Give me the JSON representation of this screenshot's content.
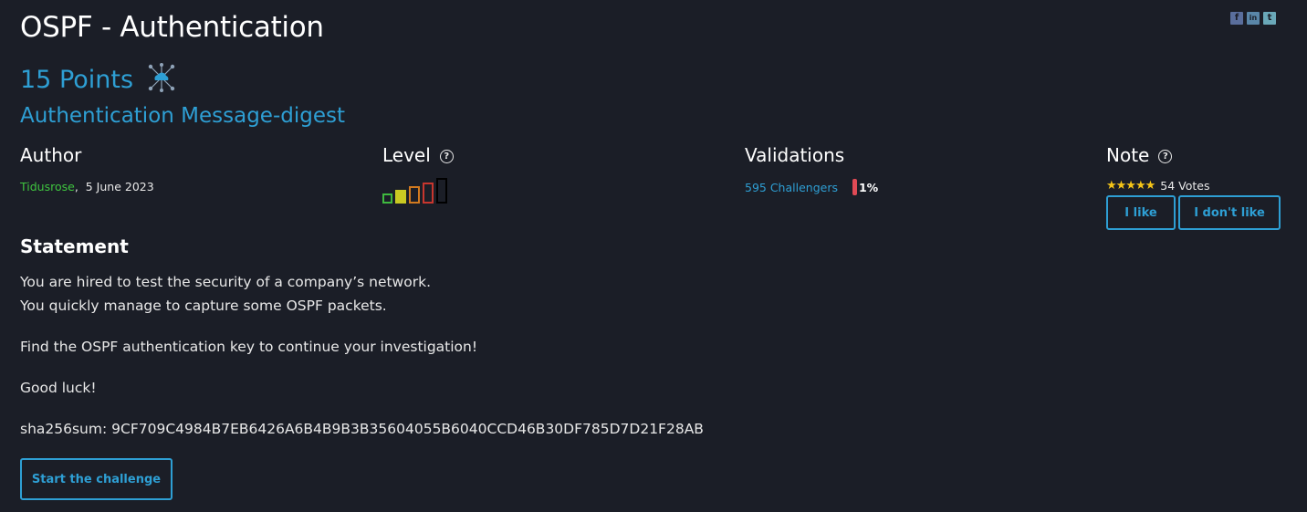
{
  "title": "OSPF - Authentication",
  "social": {
    "facebook": "f",
    "linkedin": "in",
    "twitter": "t"
  },
  "points": "15 Points",
  "category_icon": "cloud-network-icon",
  "subtitle": "Authentication Message-digest",
  "author": {
    "heading": "Author",
    "name": "Tidusrose",
    "separator": ",",
    "date": "5 June 2023"
  },
  "level": {
    "heading": "Level",
    "current": 2,
    "max": 5
  },
  "validations": {
    "heading": "Validations",
    "challengers": "595 Challengers",
    "percent": "1%"
  },
  "note": {
    "heading": "Note",
    "stars": "★★★★★",
    "votes": "54 Votes",
    "like_label": "I like",
    "dislike_label": "I don't like"
  },
  "statement": {
    "heading": "Statement",
    "line1": "You are hired to test the security of a company’s network.",
    "line2": "You quickly manage to capture some OSPF packets.",
    "line3": "Find the OSPF authentication key to continue your investigation!",
    "line4": "Good luck!",
    "line5": "sha256sum: 9CF709C4984B7EB6426A6B4B9B3B35604055B6040CCD46B30DF785D7D21F28AB"
  },
  "start_label": "Start the challenge",
  "colors": {
    "background": "#1b1e27",
    "accent": "#2e9fd4",
    "author": "#3fc43f",
    "percent_bar": "#e04a55",
    "star": "#f5c518"
  }
}
